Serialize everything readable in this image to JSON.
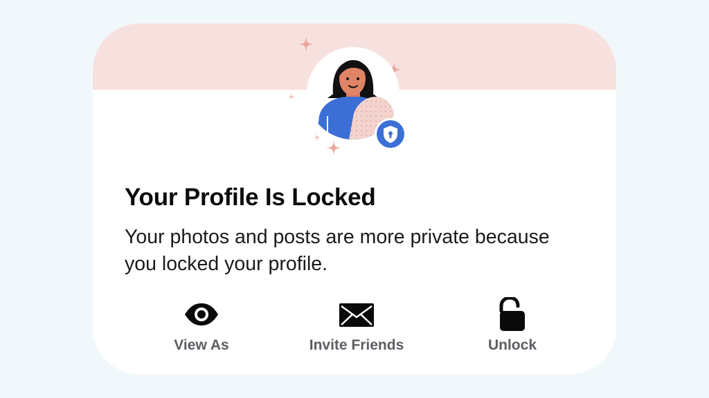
{
  "card": {
    "title": "Your Profile Is Locked",
    "description": "Your photos and posts are more private because you locked your profile."
  },
  "actions": [
    {
      "label": "View As",
      "icon": "eye-icon"
    },
    {
      "label": "Invite Friends",
      "icon": "envelope-icon"
    },
    {
      "label": "Unlock",
      "icon": "unlocked-padlock-icon"
    }
  ],
  "illustration": {
    "avatar": "woman-avatar-illustration",
    "badge_icon": "shield-lock-icon"
  },
  "colors": {
    "page_background": "#f1f8fc",
    "card_background": "#ffffff",
    "banner_pink": "#f7e1de",
    "badge_blue": "#3b6fd6",
    "sparkle": "#e8a79b",
    "label_gray": "#5b5e62",
    "title_black": "#0a0a0a"
  }
}
